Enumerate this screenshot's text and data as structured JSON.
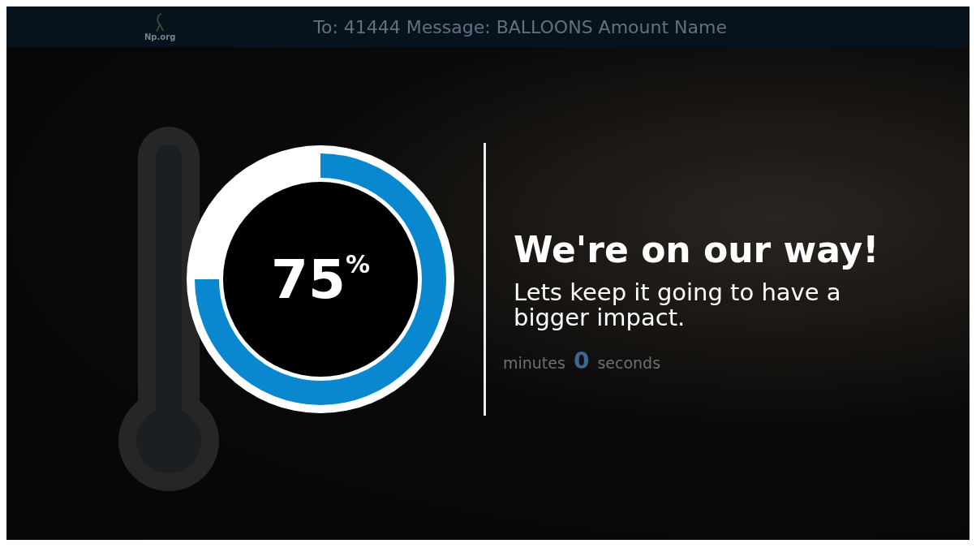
{
  "header": {
    "logo": "Np.org",
    "instructions": "To: 41444 Message: BALLOONS Amount Name"
  },
  "background": {
    "minutes_label": "minutes",
    "seconds_value": "0",
    "seconds_label": "seconds"
  },
  "progress": {
    "level": 0.75,
    "value": "75",
    "unit": "%"
  },
  "message": {
    "title": "We're on our way!",
    "body": "Lets keep it going to have a bigger impact."
  }
}
